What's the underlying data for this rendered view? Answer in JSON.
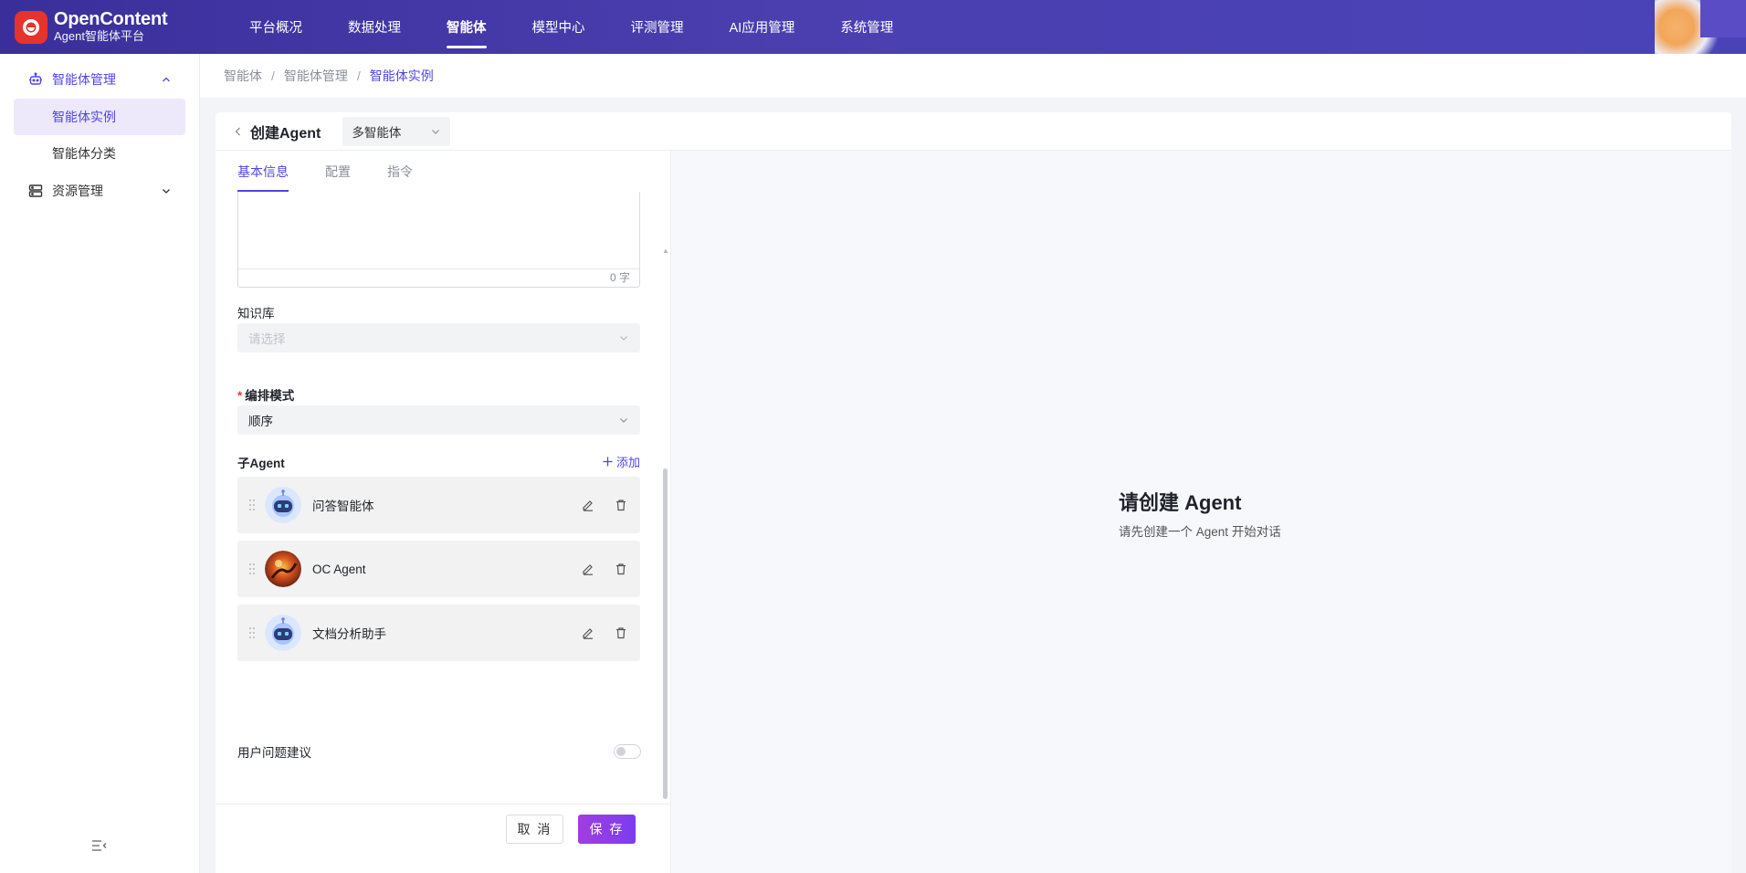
{
  "app": {
    "name": "OpenContent",
    "subtitle": "Agent智能体平台"
  },
  "nav": {
    "items": [
      "平台概况",
      "数据处理",
      "智能体",
      "模型中心",
      "评测管理",
      "AI应用管理",
      "系统管理"
    ],
    "active": "智能体"
  },
  "sidebar": {
    "group_agent_mgmt": "智能体管理",
    "item_instances": "智能体实例",
    "item_categories": "智能体分类",
    "group_resources": "资源管理"
  },
  "breadcrumb": [
    "智能体",
    "智能体管理",
    "智能体实例"
  ],
  "editor": {
    "title": "创建Agent",
    "agent_type": "多智能体",
    "tabs": [
      "基本信息",
      "配置",
      "指令"
    ],
    "active_tab": "基本信息",
    "char_count": "0 字",
    "knowledge_label": "知识库",
    "knowledge_placeholder": "请选择",
    "mode_label": "编排模式",
    "mode_value": "顺序",
    "sub_agent_label": "子Agent",
    "add_label": "添加",
    "sub_agents": [
      {
        "name": "问答智能体",
        "avatar": "robot-avatar"
      },
      {
        "name": "OC Agent",
        "avatar": "photo-avatar"
      },
      {
        "name": "文档分析助手",
        "avatar": "robot-avatar"
      }
    ],
    "suggestion_label": "用户问题建议",
    "suggestion_enabled": false,
    "cancel_label": "取 消",
    "save_label": "保 存"
  },
  "preview": {
    "empty_title": "请创建 Agent",
    "empty_subtitle": "请先创建一个 Agent 开始对话"
  },
  "colors": {
    "accent": "#4f46e5",
    "topbar": "#4b3fb0",
    "save_button": "#8b3de8"
  }
}
